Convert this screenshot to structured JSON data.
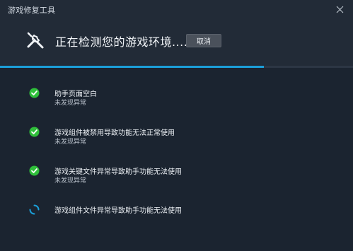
{
  "window": {
    "title": "游戏修复工具"
  },
  "header": {
    "status_text": "正在检测您的游戏环境......",
    "cancel_label": "取消",
    "progress": 0.747
  },
  "checks": [
    {
      "title": "助手页面空白",
      "status": "未发现异常",
      "state": "ok"
    },
    {
      "title": "游戏组件被禁用导致功能无法正常使用",
      "status": "未发现异常",
      "state": "ok"
    },
    {
      "title": "游戏关键文件异常导致助手功能无法使用",
      "status": "未发现异常",
      "state": "ok"
    },
    {
      "title": "游戏组件文件异常导致助手功能无法使用",
      "status": "",
      "state": "loading"
    }
  ],
  "colors": {
    "ok": "#2fbf3a",
    "loading": "#1b9fd9",
    "accent": "#1b9fd9"
  }
}
